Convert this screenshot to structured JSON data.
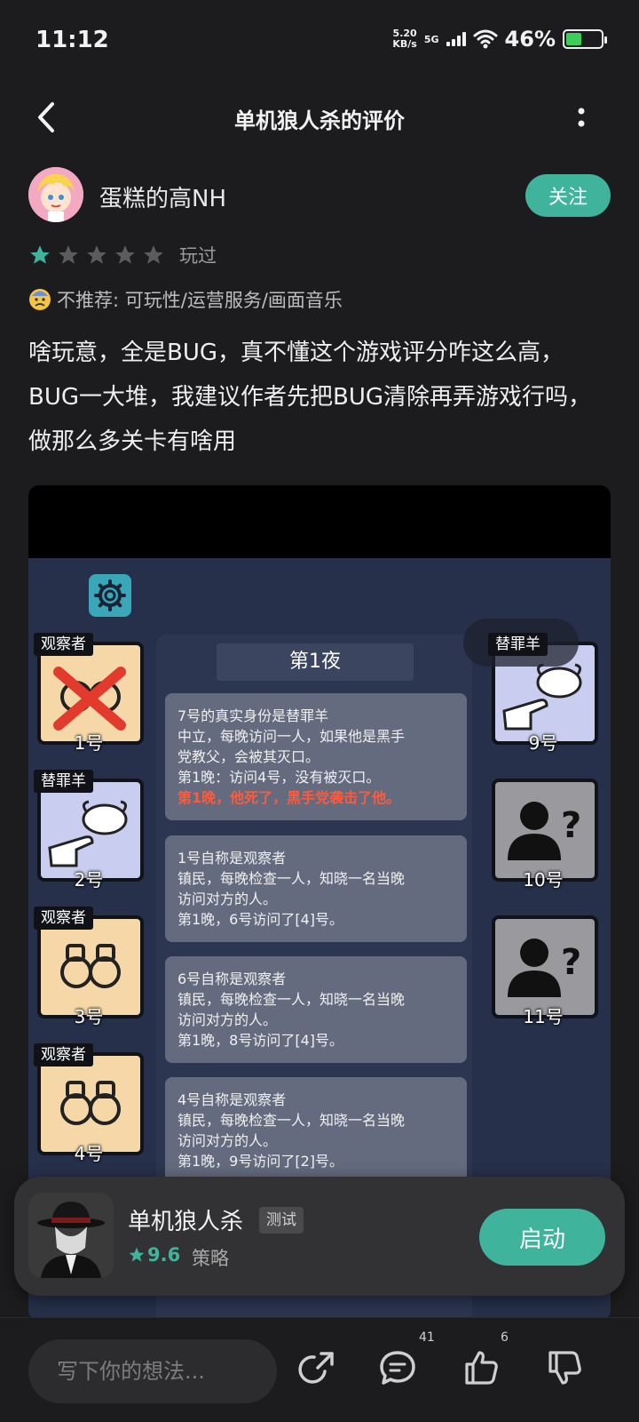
{
  "status": {
    "time": "11:12",
    "net_speed_value": "5.20",
    "net_speed_unit": "KB/s",
    "network": "5G",
    "battery": "46%",
    "battery_level": 0.46
  },
  "header": {
    "title": "单机狼人杀的评价"
  },
  "author": {
    "name": "蛋糕的高NH",
    "follow_label": "关注"
  },
  "rating": {
    "stars": 1,
    "max_stars": 5,
    "played_label": "玩过",
    "star_on_color": "#3fb39c",
    "star_off_color": "#5c5c5e"
  },
  "not_recommend": {
    "text": "不推荐: 可玩性/运营服务/画面音乐"
  },
  "review": {
    "text": "啥玩意，全是BUG，真不懂这个游戏评分咋这么高，BUG一大堆，我建议作者先把BUG清除再弄游戏行吗，做那么多关卡有啥用"
  },
  "screenshot": {
    "night_label": "第1夜",
    "left_chars": [
      {
        "tag": "观察者",
        "num": "1号"
      },
      {
        "tag": "替罪羊",
        "num": "2号"
      },
      {
        "tag": "观察者",
        "num": "3号"
      },
      {
        "tag": "观察者",
        "num": "4号"
      }
    ],
    "right_chars": [
      {
        "tag": "替罪羊",
        "num": "9号"
      },
      {
        "tag": "",
        "num": "10号"
      },
      {
        "tag": "",
        "num": "11号"
      }
    ],
    "logs": [
      {
        "l1": "7号的真实身份是替罪羊",
        "l2": "中立，每晚访问一人，如果他是黑手",
        "l3": "党教父，会被其灭口。",
        "l4": "第1晚：访问4号，没有被灭口。",
        "l5": "第1晚，他死了，黑手党袭击了他。"
      },
      {
        "l1": "1号自称是观察者",
        "l2": "镇民，每晚检查一人，知晓一名当晚",
        "l3": "访问对方的人。",
        "l4": "第1晚，6号访问了[4]号。"
      },
      {
        "l1": "6号自称是观察者",
        "l2": "镇民，每晚检查一人，知晓一名当晚",
        "l3": "访问对方的人。",
        "l4": "第1晚，8号访问了[4]号。"
      },
      {
        "l1": "4号自称是观察者",
        "l2": "镇民，每晚检查一人，知晓一名当晚",
        "l3": "访问对方的人。",
        "l4": "第1晚，9号访问了[2]号。"
      }
    ]
  },
  "app": {
    "name": "单机狼人杀",
    "tag": "测试",
    "score": "9.6",
    "category": "策略",
    "launch_label": "启动"
  },
  "bottom": {
    "placeholder": "写下你的想法...",
    "comment_count": "41",
    "like_count": "6"
  }
}
